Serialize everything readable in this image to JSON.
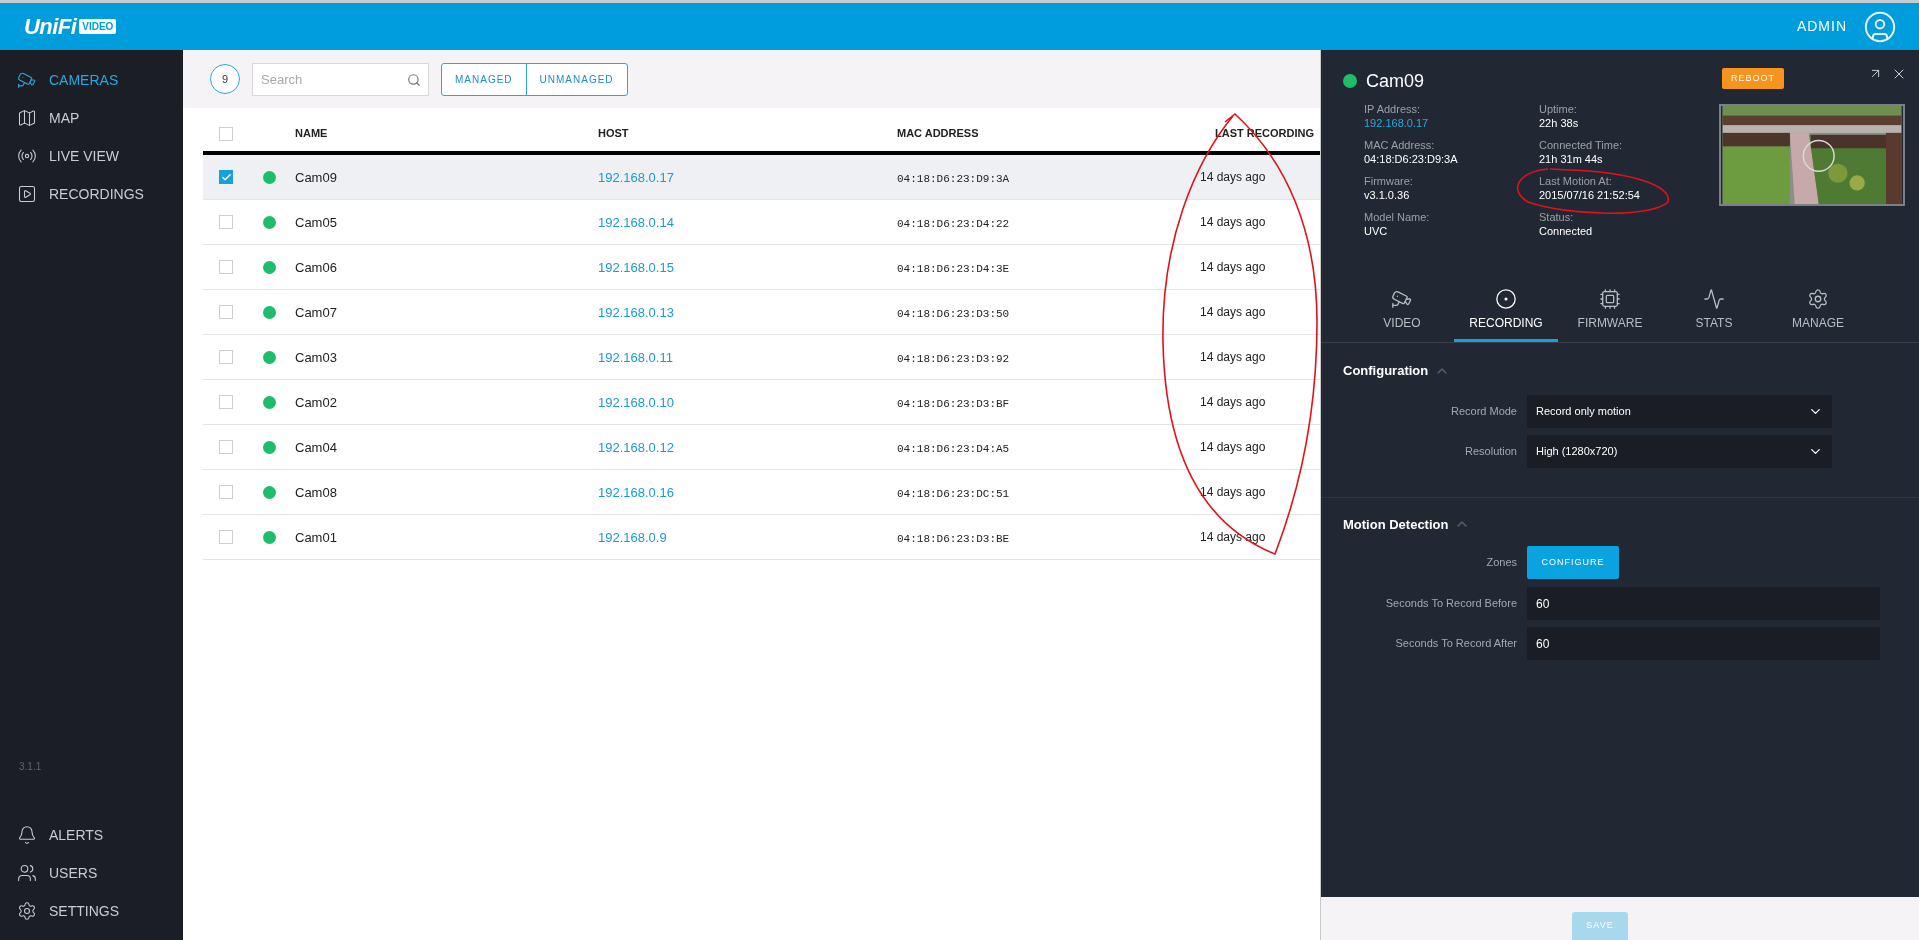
{
  "header": {
    "logo": "UniFi",
    "logo_badge": "VIDEO",
    "user": "ADMIN"
  },
  "sidebar": {
    "items": [
      {
        "kind": "cameras",
        "label": "CAMERAS",
        "selected": true
      },
      {
        "kind": "map",
        "label": "MAP",
        "selected": false
      },
      {
        "kind": "live",
        "label": "LIVE VIEW",
        "selected": false
      },
      {
        "kind": "recordings",
        "label": "RECORDINGS",
        "selected": false
      }
    ],
    "version": "3.1.1",
    "bottom_items": [
      {
        "kind": "alerts",
        "label": "ALERTS"
      },
      {
        "kind": "users",
        "label": "USERS"
      },
      {
        "kind": "settings",
        "label": "SETTINGS"
      }
    ]
  },
  "toolbar": {
    "count": "9",
    "search": {
      "placeholder": "Search"
    },
    "filters": [
      {
        "label": "MANAGED"
      },
      {
        "label": "UNMANAGED"
      }
    ]
  },
  "table": {
    "header_checked": false,
    "columns": [
      "NAME",
      "HOST",
      "MAC ADDRESS",
      "LAST RECORDING"
    ],
    "rows": [
      {
        "checked": true,
        "selected": true,
        "color": "#1dbd6c",
        "name": "Cam09",
        "host": "192.168.0.17",
        "mac": "04:18:D6:23:D9:3A",
        "last": "14 days ago"
      },
      {
        "checked": false,
        "selected": false,
        "color": "#1dbd6c",
        "name": "Cam05",
        "host": "192.168.0.14",
        "mac": "04:18:D6:23:D4:22",
        "last": "14 days ago"
      },
      {
        "checked": false,
        "selected": false,
        "color": "#1dbd6c",
        "name": "Cam06",
        "host": "192.168.0.15",
        "mac": "04:18:D6:23:D4:3E",
        "last": "14 days ago"
      },
      {
        "checked": false,
        "selected": false,
        "color": "#1dbd6c",
        "name": "Cam07",
        "host": "192.168.0.13",
        "mac": "04:18:D6:23:D3:50",
        "last": "14 days ago"
      },
      {
        "checked": false,
        "selected": false,
        "color": "#1dbd6c",
        "name": "Cam03",
        "host": "192.168.0.11",
        "mac": "04:18:D6:23:D3:92",
        "last": "14 days ago"
      },
      {
        "checked": false,
        "selected": false,
        "color": "#1dbd6c",
        "name": "Cam02",
        "host": "192.168.0.10",
        "mac": "04:18:D6:23:D3:BF",
        "last": "14 days ago"
      },
      {
        "checked": false,
        "selected": false,
        "color": "#1dbd6c",
        "name": "Cam04",
        "host": "192.168.0.12",
        "mac": "04:18:D6:23:D4:A5",
        "last": "14 days ago"
      },
      {
        "checked": false,
        "selected": false,
        "color": "#1dbd6c",
        "name": "Cam08",
        "host": "192.168.0.16",
        "mac": "04:18:D6:23:DC:51",
        "last": "14 days ago"
      },
      {
        "checked": false,
        "selected": false,
        "color": "#1dbd6c",
        "name": "Cam01",
        "host": "192.168.0.9",
        "mac": "04:18:D6:23:D3:BE",
        "last": "14 days ago"
      }
    ]
  },
  "panel": {
    "title": "Cam09",
    "color": "#1dbd6c",
    "reboot": "REBOOT",
    "info_left": [
      {
        "label": "IP Address:",
        "value": "192.168.0.17",
        "kind": "link"
      },
      {
        "label": "MAC Address:",
        "value": "04:18:D6:23:D9:3A",
        "kind": "text"
      },
      {
        "label": "Firmware:",
        "value": "v3.1.0.36",
        "kind": "text"
      },
      {
        "label": "Model Name:",
        "value": "UVC",
        "kind": "text"
      }
    ],
    "info_right": [
      {
        "label": "Uptime:",
        "value": "22h 38s"
      },
      {
        "label": "Connected Time:",
        "value": "21h 31m 44s"
      },
      {
        "label": "Last Motion At:",
        "value": "2015/07/16 21:52:54"
      },
      {
        "label": "Status:",
        "value": "Connected"
      }
    ],
    "tabs": [
      {
        "kind": "video",
        "label": "VIDEO",
        "selected": false
      },
      {
        "kind": "recording",
        "label": "RECORDING",
        "selected": true
      },
      {
        "kind": "firmware",
        "label": "FIRMWARE",
        "selected": false
      },
      {
        "kind": "stats",
        "label": "STATS",
        "selected": false
      },
      {
        "kind": "manage",
        "label": "MANAGE",
        "selected": false
      }
    ],
    "configuration": {
      "title": "Configuration",
      "expanded": true,
      "fields": [
        {
          "label": "Record Mode",
          "value": "Record only motion"
        },
        {
          "label": "Resolution",
          "value": "High (1280x720)"
        }
      ]
    },
    "motion": {
      "title": "Motion Detection",
      "expanded": true,
      "zones_label": "Zones",
      "zones_button": "CONFIGURE",
      "fields": [
        {
          "label": "Seconds To Record Before",
          "value": "60"
        },
        {
          "label": "Seconds To Record After",
          "value": "60"
        }
      ]
    },
    "save": {
      "label": "SAVE",
      "disabled": true
    }
  }
}
